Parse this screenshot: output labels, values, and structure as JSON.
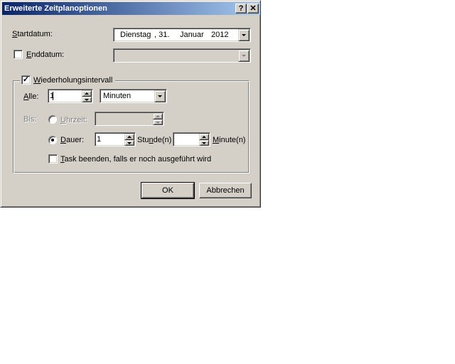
{
  "window": {
    "title": "Erweiterte Zeitplanoptionen",
    "help_btn": "?",
    "close_btn": "✕"
  },
  "startdatum": {
    "label_ul": "S",
    "label_rest": "tartdatum:",
    "weekday": "Dienstag",
    "day": ", 31.",
    "month": "Januar",
    "year": "2012"
  },
  "enddatum": {
    "label_ul": "E",
    "label_rest": "nddatum:",
    "checked": false
  },
  "wiederholung": {
    "legend_ul": "W",
    "legend_rest": "iederholungsintervall",
    "checked": true,
    "alle_label_ul": "A",
    "alle_label_rest": "lle:",
    "alle_value": "1",
    "unit_value": "Minuten",
    "bis_label": "Bis:",
    "uhrzeit_label_ul": "U",
    "uhrzeit_label_rest": "hrzeit:",
    "uhrzeit_selected": false,
    "dauer_label_ul": "D",
    "dauer_label_rest": "auer:",
    "dauer_selected": true,
    "dauer_stunden_value": "1",
    "stunden_label_a": "Stu",
    "stunden_label_ul": "n",
    "stunden_label_b": "de(n)",
    "dauer_minuten_value": "",
    "minuten_label_ul": "M",
    "minuten_label_rest": "inute(n)",
    "task_label_ul": "T",
    "task_label_rest": "ask beenden, falls er noch ausgeführt wird",
    "task_checked": false
  },
  "buttons": {
    "ok": "OK",
    "cancel": "Abbrechen"
  }
}
